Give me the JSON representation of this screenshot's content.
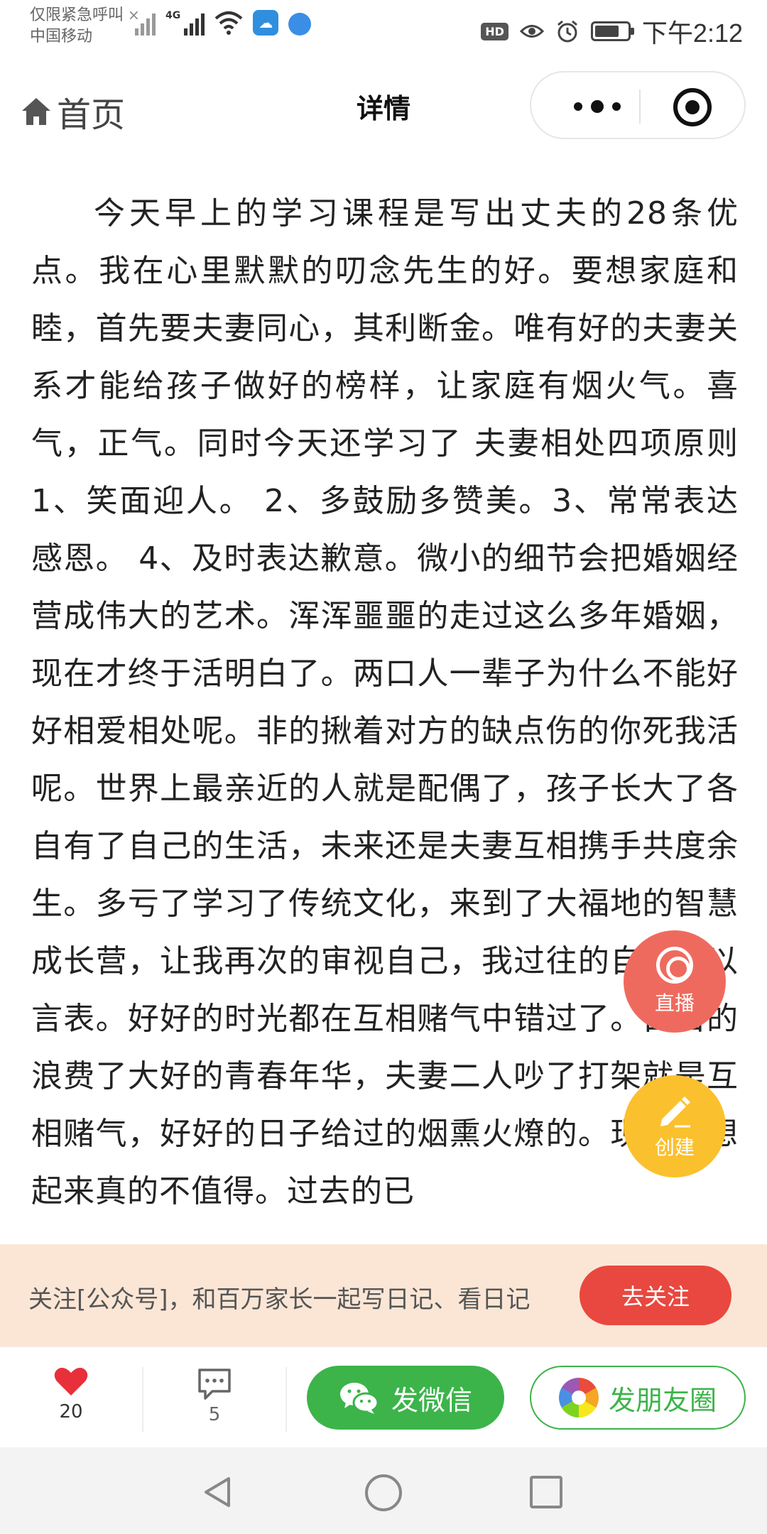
{
  "status_bar": {
    "carrier_line1": "仅限紧急呼叫",
    "carrier_line2": "中国移动",
    "close_mark": "×",
    "network_label": "4G",
    "hd_label": "HD",
    "time": "下午2:12",
    "battery_level": 0.75
  },
  "navbar": {
    "home_label": "首页",
    "title": "详情"
  },
  "article": {
    "text": "今天早上的学习课程是写出丈夫的28条优点。我在心里默默的叨念先生的好。要想家庭和睦，首先要夫妻同心，其利断金。唯有好的夫妻关系才能给孩子做好的榜样，让家庭有烟火气。喜气，正气。同时今天还学习了 夫妻相处四项原则1、笑面迎人。 2、多鼓励多赞美。3、常常表达感恩。 4、及时表达歉意。微小的细节会把婚姻经营成伟大的艺术。浑浑噩噩的走过这么多年婚姻，现在才终于活明白了。两口人一辈子为什么不能好好相爱相处呢。非的揪着对方的缺点伤的你死我活呢。世界上最亲近的人就是配偶了，孩子长大了各自有了自己的生活，未来还是夫妻互相携手共度余生。多亏了学习了传统文化，来到了大福地的智慧成长营，让我再次的审视自己，我过往的自责无以言表。好好的时光都在互相赌气中错过了。白白的浪费了大好的青春年华，夫妻二人吵了打架就是互相赌气，好好的日子给过的烟熏火燎的。现在回想起来真的不值得。过去的已"
  },
  "floating": {
    "live_label": "直播",
    "create_label": "创建"
  },
  "follow_banner": {
    "text": "关注[公众号]，和百万家长一起写日记、看日记",
    "button_label": "去关注"
  },
  "actions": {
    "like_count": "20",
    "comment_count": "5",
    "wechat_label": "发微信",
    "moments_label": "发朋友圈"
  },
  "colors": {
    "like_red": "#e8303a",
    "wechat_green": "#3cb44a",
    "follow_red": "#e8483f",
    "banner_bg": "#fbe6d6",
    "live_fab": "#ef6a5e",
    "create_fab": "#fbc02d"
  }
}
